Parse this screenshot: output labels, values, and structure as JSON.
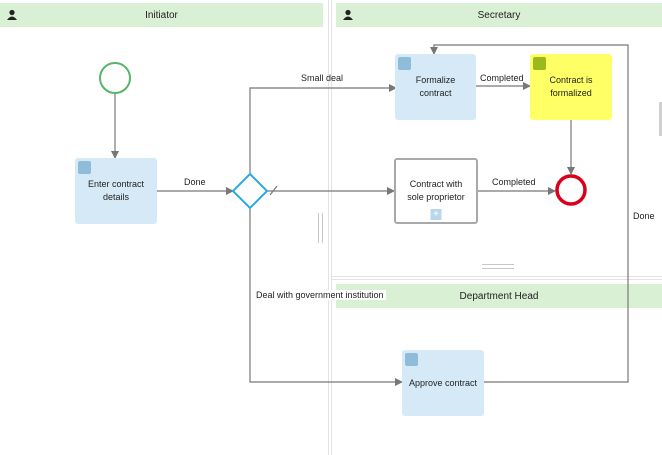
{
  "lanes": {
    "initiator": "Initiator",
    "secretary": "Secretary",
    "department_head": "Department Head"
  },
  "tasks": {
    "enter_contract_details": "Enter contract details",
    "formalize_contract": "Formalize contract",
    "contract_is_formalized": "Contract is formalized",
    "contract_sole_proprietor": "Contract with sole proprietor",
    "approve_contract": "Approve contract"
  },
  "flows": {
    "done_from_enter": "Done",
    "small_deal": "Small deal",
    "completed_formalize": "Completed",
    "completed_sole": "Completed",
    "deal_gov": "Deal with government institution",
    "done_approve": "Done"
  },
  "colors": {
    "lane_header": "#d9f0d4",
    "task_blue": "#d5eaf6",
    "notification_yellow": "#ffff66",
    "start_event": "#57b56a",
    "end_event": "#d9001b",
    "gateway": "#29a9e1",
    "flow_line": "#777777"
  }
}
